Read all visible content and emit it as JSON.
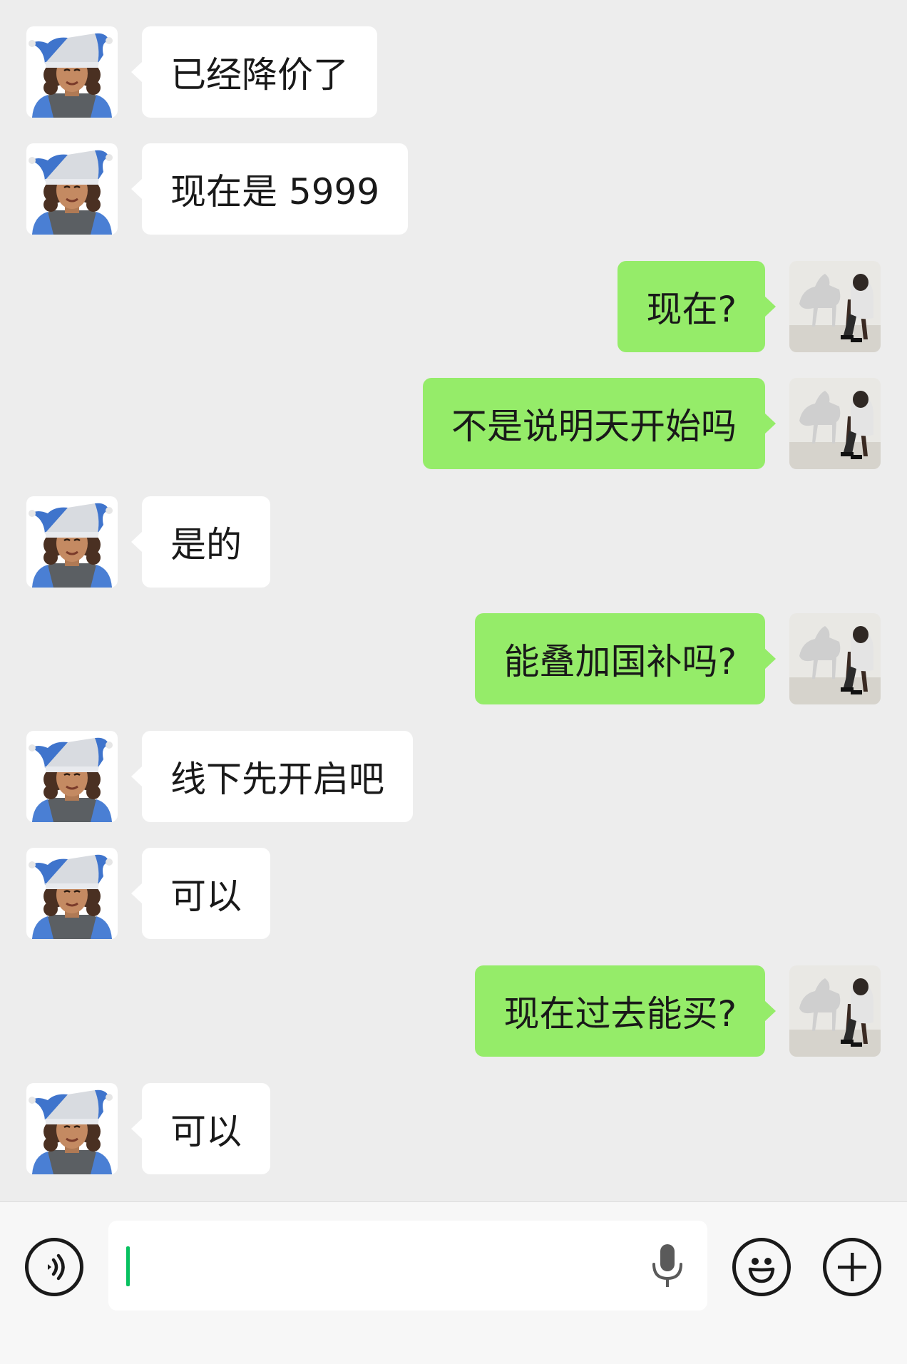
{
  "colors": {
    "background": "#ededed",
    "incoming_bubble": "#ffffff",
    "outgoing_bubble": "#95ec69",
    "caret": "#07c160"
  },
  "messages": [
    {
      "side": "left",
      "avatar": "jester-memoji-avatar",
      "text": "已经降价了"
    },
    {
      "side": "left",
      "avatar": "jester-memoji-avatar",
      "text": "现在是 5999"
    },
    {
      "side": "right",
      "avatar": "horse-statue-photo-avatar",
      "text": "现在?"
    },
    {
      "side": "right",
      "avatar": "horse-statue-photo-avatar",
      "text": "不是说明天开始吗"
    },
    {
      "side": "left",
      "avatar": "jester-memoji-avatar",
      "text": "是的"
    },
    {
      "side": "right",
      "avatar": "horse-statue-photo-avatar",
      "text": "能叠加国补吗?"
    },
    {
      "side": "left",
      "avatar": "jester-memoji-avatar",
      "text": "线下先开启吧"
    },
    {
      "side": "left",
      "avatar": "jester-memoji-avatar",
      "text": "可以"
    },
    {
      "side": "right",
      "avatar": "horse-statue-photo-avatar",
      "text": "现在过去能买?"
    },
    {
      "side": "left",
      "avatar": "jester-memoji-avatar",
      "text": "可以"
    }
  ],
  "input_bar": {
    "voice_icon": "voice-mode-icon",
    "input_value": "",
    "mic_icon": "microphone-icon",
    "emoji_icon": "emoji-icon",
    "plus_icon": "plus-icon"
  }
}
